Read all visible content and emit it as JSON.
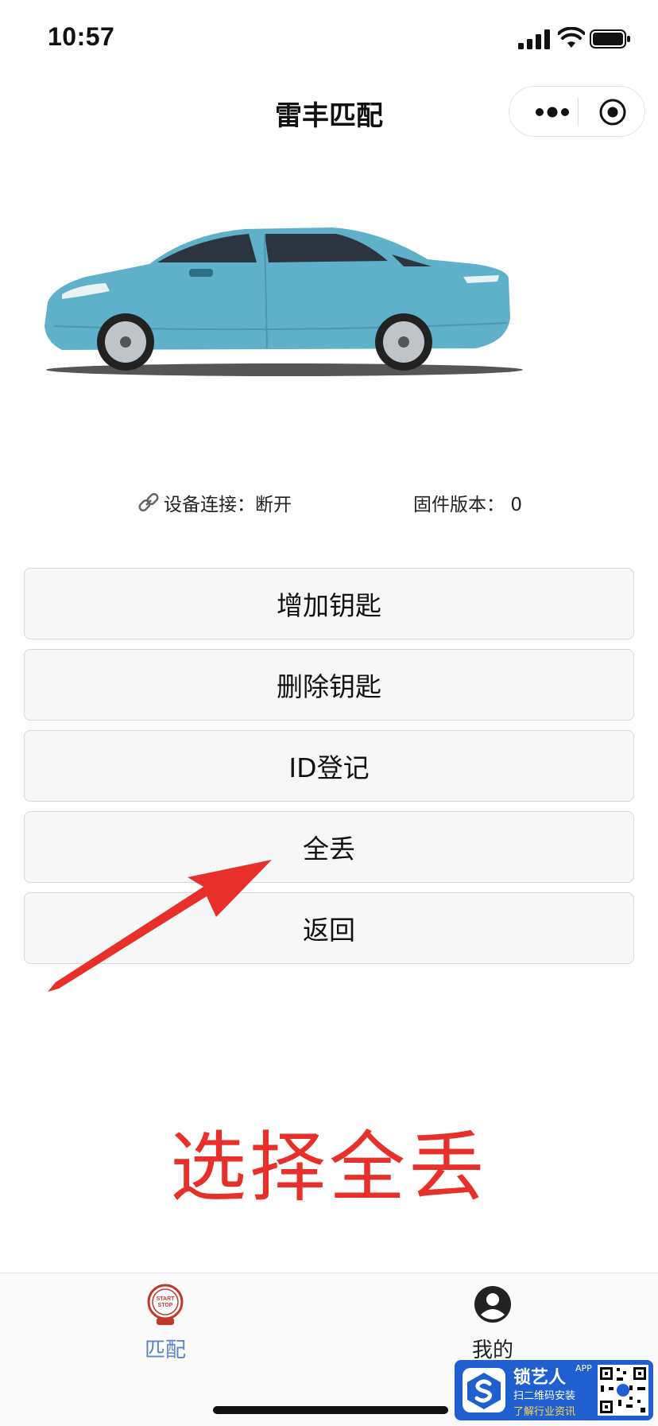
{
  "status_bar": {
    "time": "10:57"
  },
  "nav": {
    "title": "雷丰匹配"
  },
  "device": {
    "connection_label": "设备连接：",
    "connection_value": "断开",
    "firmware_label": "固件版本：",
    "firmware_value": "0"
  },
  "buttons": [
    {
      "label": "增加钥匙"
    },
    {
      "label": "删除钥匙"
    },
    {
      "label": "ID登记"
    },
    {
      "label": "全丢"
    },
    {
      "label": "返回"
    }
  ],
  "annotation": {
    "text": "选择全丢",
    "color": "#e8302a"
  },
  "tab_bar": {
    "items": [
      {
        "label": "匹配",
        "icon": "start-stop-icon",
        "active": true
      },
      {
        "label": "我的",
        "icon": "profile-icon",
        "active": false
      }
    ],
    "active_color": "#5b86c4"
  },
  "watermark": {
    "brand": "锁艺人",
    "app_tag": "APP",
    "line2": "扫二维码安装",
    "line3": "了解行业资讯"
  }
}
